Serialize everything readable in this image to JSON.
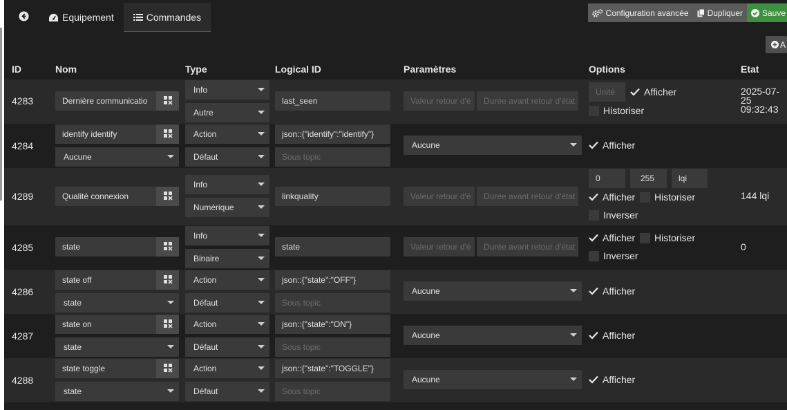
{
  "tabs": {
    "equipement": "Equipement",
    "commandes": "Commandes"
  },
  "toolbar": {
    "config": "Configuration avancée",
    "dupliquer": "Dupliquer",
    "sauver": "Sauve",
    "add": "A"
  },
  "headers": {
    "id": "ID",
    "nom": "Nom",
    "type": "Type",
    "logical_id": "Logical ID",
    "parametres": "Paramètres",
    "options": "Options",
    "etat": "Etat"
  },
  "labels": {
    "afficher": "Afficher",
    "historiser": "Historiser",
    "inverser": "Inverser"
  },
  "placeholders": {
    "unite": "Unité",
    "valeur_retour": "Valeur retour d'é",
    "duree_retour": "Durée avant retour d'état",
    "sous_topic": "Sous topic"
  },
  "rows": [
    {
      "id": "4283",
      "name": "Dernière communicatio",
      "type": "Info",
      "subtype": "Autre",
      "logical_id": "last_seen",
      "unit": "",
      "etat": [
        "2025-07-",
        "25",
        "09:32:43"
      ]
    },
    {
      "id": "4284",
      "name": "identify identify",
      "value": "Aucune",
      "type": "Action",
      "subtype": "Défaut",
      "logical_id": "json::{\"identify\":\"identify\"}",
      "param": "Aucune"
    },
    {
      "id": "4289",
      "name": "Qualité connexion",
      "type": "Info",
      "subtype": "Numérique",
      "logical_id": "linkquality",
      "min": "0",
      "max": "255",
      "unit": "lqi",
      "etat": "144 lqi"
    },
    {
      "id": "4285",
      "name": "state",
      "type": "Info",
      "subtype": "Binaire",
      "logical_id": "state",
      "etat": "0"
    },
    {
      "id": "4286",
      "name": "state off",
      "value": "state",
      "type": "Action",
      "subtype": "Défaut",
      "logical_id": "json::{\"state\":\"OFF\"}",
      "param": "Aucune"
    },
    {
      "id": "4287",
      "name": "state on",
      "value": "state",
      "type": "Action",
      "subtype": "Défaut",
      "logical_id": "json::{\"state\":\"ON\"}",
      "param": "Aucune"
    },
    {
      "id": "4288",
      "name": "state toggle",
      "value": "state",
      "type": "Action",
      "subtype": "Défaut",
      "logical_id": "json::{\"state\":\"TOGGLE\"}",
      "param": "Aucune"
    }
  ],
  "colors": {
    "background": "#1e1e1e",
    "row_alt": "#2a2a2a",
    "input": "#3a3a3a",
    "button": "#5b5b5b",
    "green": "#3f8f40"
  }
}
